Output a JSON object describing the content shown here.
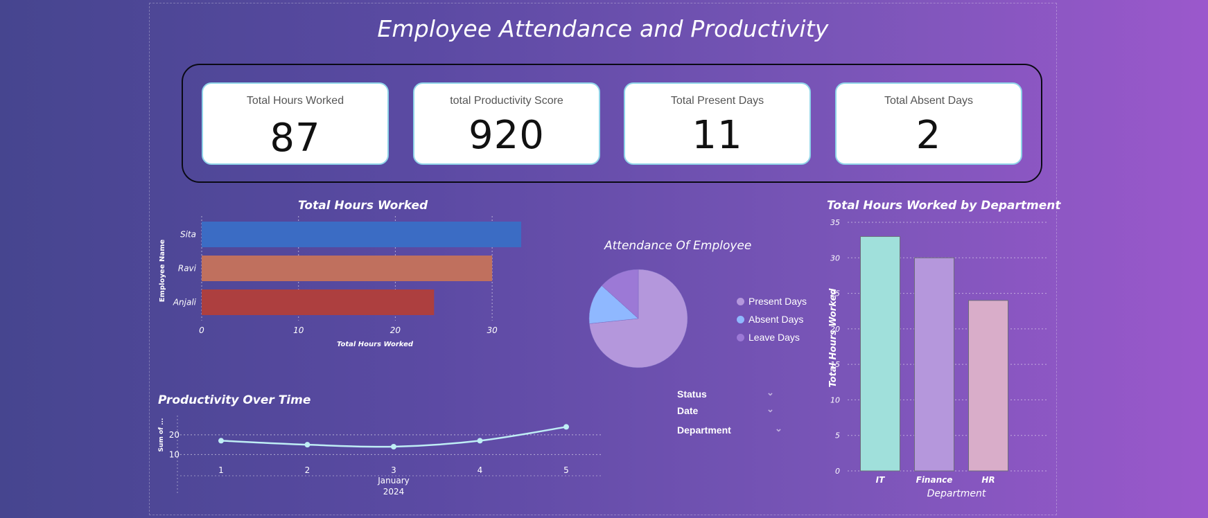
{
  "page": {
    "title": "Employee Attendance and Productivity",
    "colors": {
      "bg_left": "#46458f",
      "bg_right": "#9b58cc",
      "card_border": "#8fd3e8"
    }
  },
  "kpis": [
    {
      "label": "Total Hours Worked",
      "value": "87"
    },
    {
      "label": "total Productivity Score",
      "value": "920"
    },
    {
      "label": "Total Present Days",
      "value": "11"
    },
    {
      "label": "Total Absent Days",
      "value": "2"
    }
  ],
  "slicers": [
    {
      "label": "Status",
      "icon": "chevron-down-icon"
    },
    {
      "label": "Date",
      "icon": "chevron-down-icon"
    },
    {
      "label": "Department",
      "icon": "chevron-down-icon"
    }
  ],
  "chart_data": [
    {
      "type": "bar",
      "orientation": "horizontal",
      "title": "Total Hours Worked",
      "xlabel": "Total Hours Worked",
      "ylabel": "Employee Name",
      "categories": [
        "Sita",
        "Ravi",
        "Anjali"
      ],
      "values": [
        33,
        30,
        24
      ],
      "colors": [
        "#3b6cc4",
        "#c0705e",
        "#ad3f3f"
      ],
      "xlim": [
        0,
        34
      ],
      "xticks": [
        "0",
        "10",
        "20",
        "30"
      ],
      "xtick_values": [
        0,
        10,
        20,
        30
      ],
      "grid": true
    },
    {
      "type": "pie",
      "title": "Attendance Of Employee",
      "categories": [
        "Present Days",
        "Absent Days",
        "Leave Days"
      ],
      "values": [
        11,
        2,
        2
      ],
      "colors": [
        "#b497dc",
        "#8fb8ff",
        "#9c79d6"
      ],
      "legend": "right"
    },
    {
      "type": "bar",
      "title": "Total Hours Worked by Department",
      "xlabel": "Department",
      "ylabel": "Total Hours Worked",
      "categories": [
        "IT",
        "Finance",
        "HR"
      ],
      "values": [
        33,
        30,
        24
      ],
      "colors": [
        "#a0e0db",
        "#b597dc",
        "#d9adc9"
      ],
      "ylim": [
        0,
        35
      ],
      "yticks": [
        "0",
        "5",
        "10",
        "15",
        "20",
        "25",
        "30",
        "35"
      ],
      "ytick_values": [
        0,
        5,
        10,
        15,
        20,
        25,
        30,
        35
      ],
      "grid": true
    },
    {
      "type": "line",
      "title": "Productivity Over Time",
      "ylabel": "Sum of ...",
      "x": [
        1,
        2,
        3,
        4,
        5
      ],
      "xticks": [
        "1",
        "2",
        "3",
        "4",
        "5"
      ],
      "x_group_label": "January",
      "x_group_label2": "2024",
      "series": [
        {
          "values": [
            17,
            15,
            14,
            17,
            24
          ]
        }
      ],
      "ylim": [
        7,
        28
      ],
      "yticks": [
        "10",
        "20"
      ],
      "ytick_values": [
        10,
        20
      ],
      "color": "#bfeef5",
      "grid": true
    }
  ]
}
